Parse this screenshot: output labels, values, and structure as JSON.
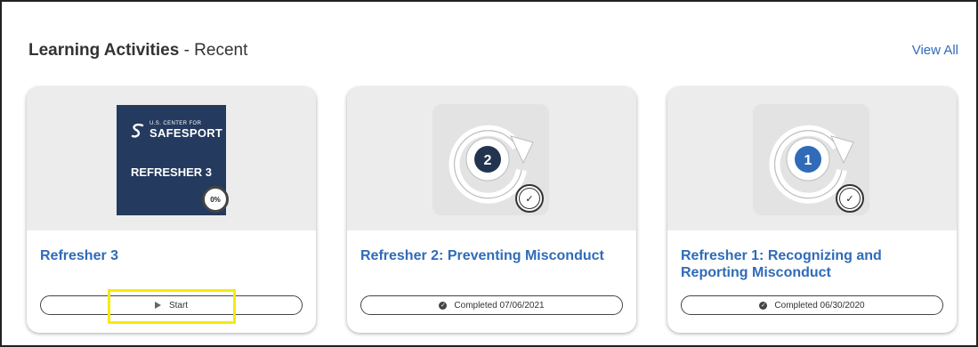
{
  "header": {
    "title_bold": "Learning Activities",
    "title_rest": " - Recent",
    "view_all": "View All"
  },
  "cards": [
    {
      "title": "Refresher 3",
      "thumbnail": {
        "logo_small": "U.S. CENTER FOR",
        "logo_big": "SAFESPORT",
        "label": "REFRESHER 3",
        "progress": "0%"
      },
      "action": {
        "icon": "play-icon",
        "label": "Start"
      }
    },
    {
      "title": "Refresher 2: Preventing Misconduct",
      "thumbnail": {
        "number": "2"
      },
      "action": {
        "icon": "check-circle-icon",
        "label": "Completed 07/06/2021"
      }
    },
    {
      "title": "Refresher 1: Recognizing and Reporting Misconduct",
      "thumbnail": {
        "number": "1"
      },
      "action": {
        "icon": "check-circle-icon",
        "label": "Completed 06/30/2020"
      }
    }
  ],
  "colors": {
    "link": "#2f6bb8",
    "safesport_bg": "#243a5e",
    "highlight": "#f5ec00",
    "badge_dark": "#22344f",
    "badge_blue": "#2f6bb8"
  }
}
